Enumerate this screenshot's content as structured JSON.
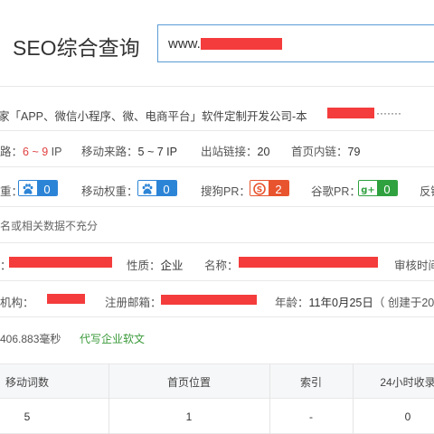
{
  "header": {
    "title": "SEO综合查询",
    "search_value": "www."
  },
  "site": {
    "title": "家「APP、微信小程序、微、电商平台」软件定制开发公司-本",
    "title_suffix": "·······"
  },
  "traffic": {
    "pc_label": "路：",
    "pc_value": "6 ~ 9",
    "pc_unit": "IP",
    "mobile_label": "移动来路：",
    "mobile_value": "5 ~ 7 IP",
    "outlinks_label": "出站链接：",
    "outlinks_value": "20",
    "inlinks_label": "首页内链：",
    "inlinks_value": "79"
  },
  "weights": {
    "baidu_label": "重：",
    "baidu_value": "0",
    "mobile_label": "移动权重：",
    "mobile_value": "0",
    "sogou_label": "搜狗PR：",
    "sogou_value": "2",
    "google_label": "谷歌PR：",
    "google_value": "0",
    "reverse_label": "反链"
  },
  "notice": "名或相关数据不充分",
  "icp": {
    "prefix": "：",
    "nature_label": "性质：",
    "nature_value": "企业",
    "name_label": "名称：",
    "audit_label": "审核时间"
  },
  "whois": {
    "org_label": "机构：",
    "email_label": "注册邮箱：",
    "age_label": "年龄：",
    "age_value": "11年0月25日",
    "age_created": "（ 创建于20"
  },
  "footer_line": {
    "response": "406.883毫秒",
    "link": "代写企业软文"
  },
  "table": {
    "headers": [
      "移动词数",
      "首页位置",
      "索引",
      "24小时收录"
    ],
    "rows": [
      [
        "5",
        "1",
        "-",
        "0"
      ]
    ]
  },
  "colors": {
    "accent_blue": "#2c84d6",
    "sogou_orange": "#e8542e",
    "google_green": "#2fa13f",
    "redaction_red": "#f43c3c"
  }
}
